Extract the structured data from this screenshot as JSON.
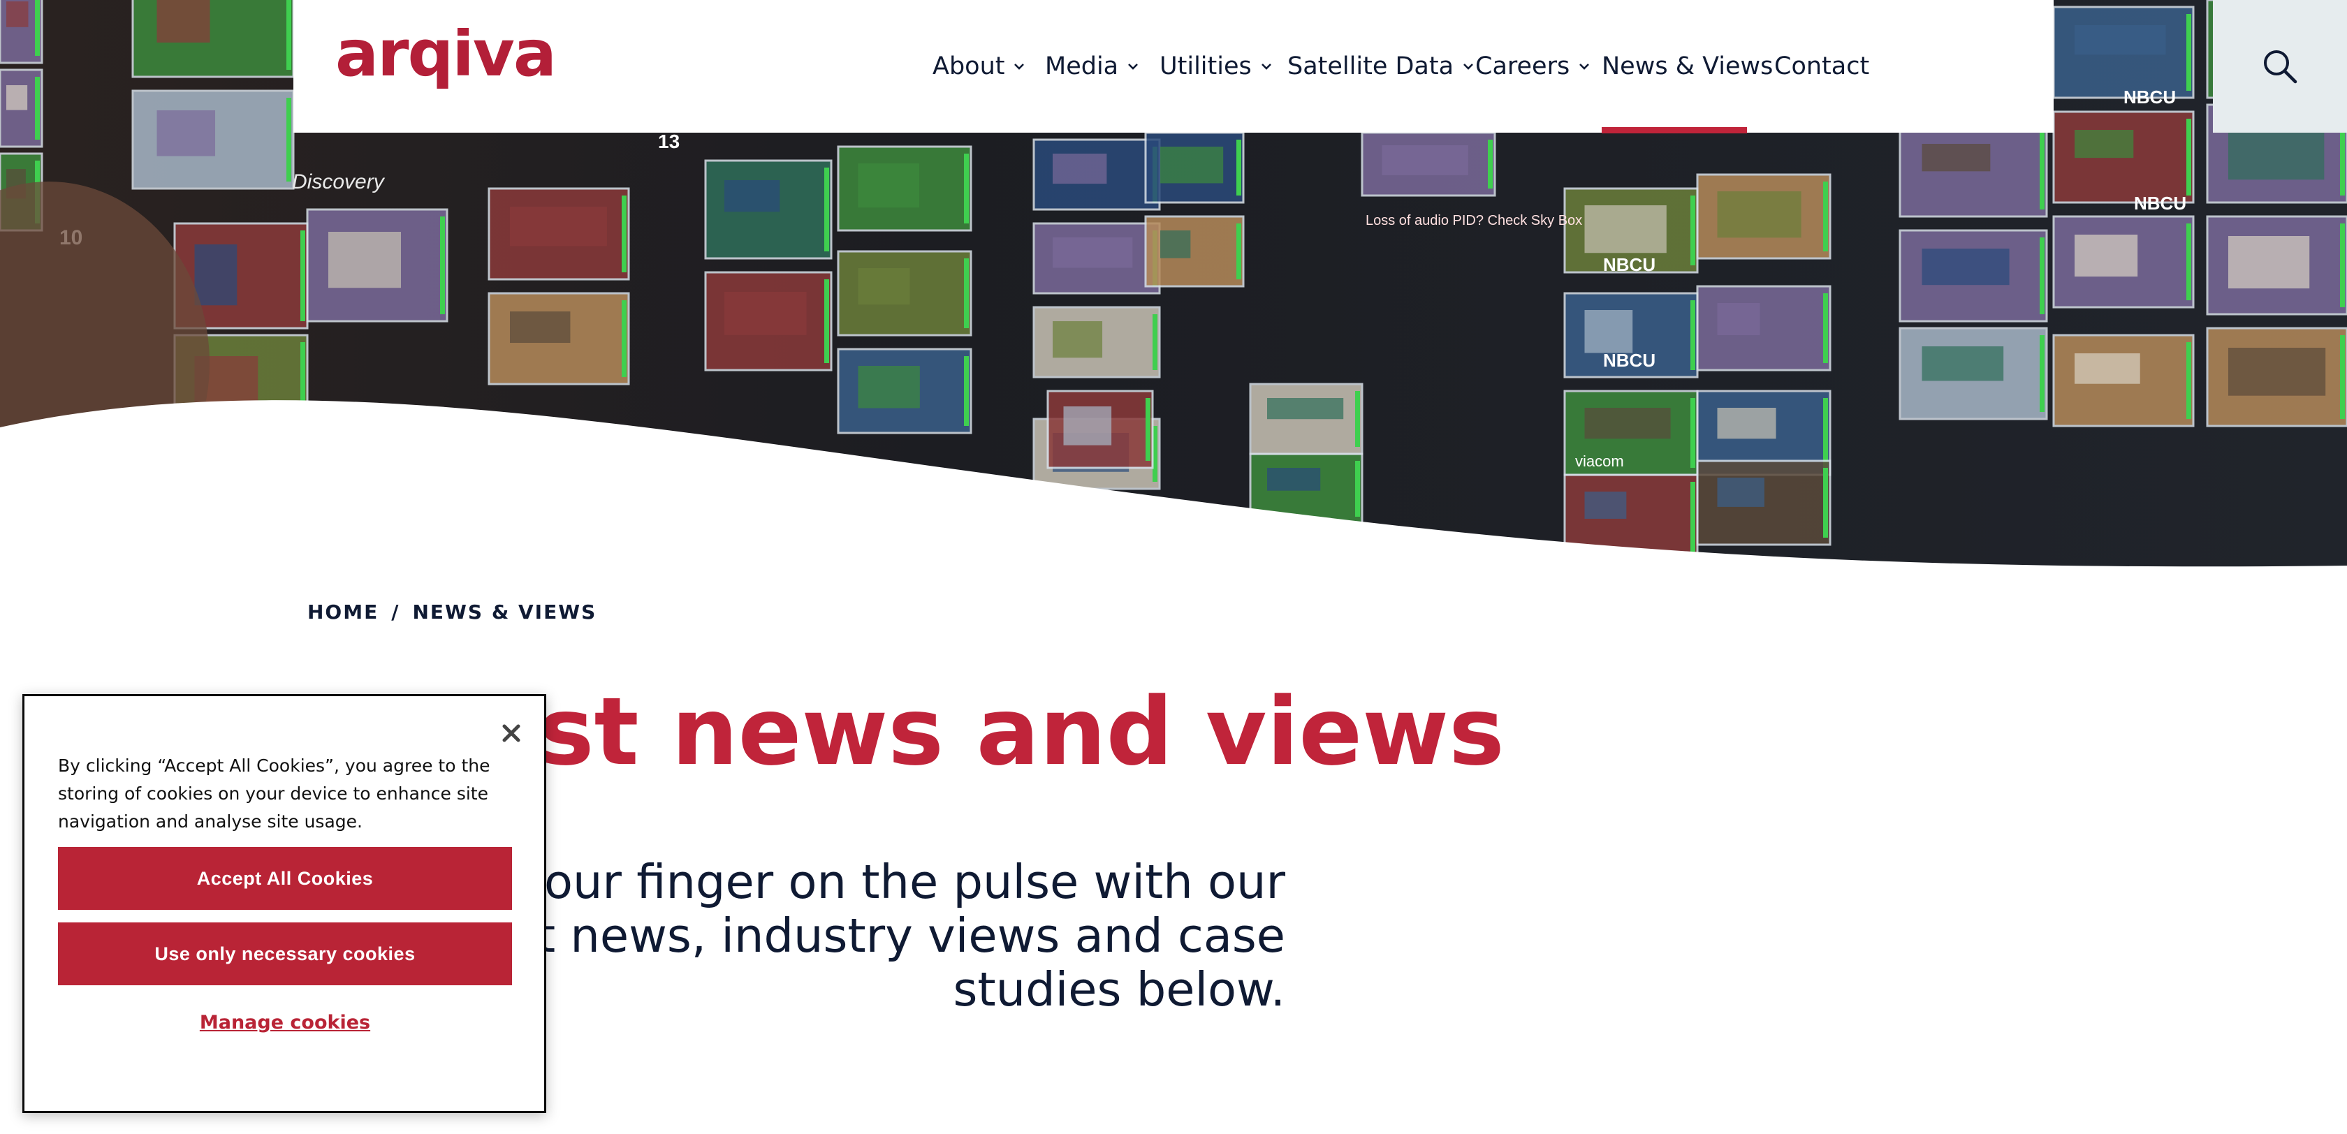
{
  "brand": {
    "logo_text": "arqiva",
    "accent": "#c0243a",
    "text_dark": "#0f1a33"
  },
  "nav": {
    "items": [
      {
        "label": "About",
        "has_dropdown": true
      },
      {
        "label": "Media",
        "has_dropdown": true
      },
      {
        "label": "Utilities",
        "has_dropdown": true
      },
      {
        "label": "Satellite Data",
        "has_dropdown": true
      },
      {
        "label": "Careers",
        "has_dropdown": true
      },
      {
        "label": "News & Views",
        "has_dropdown": false,
        "active": true
      },
      {
        "label": "Contact",
        "has_dropdown": false
      }
    ],
    "search_icon": "search-icon"
  },
  "breadcrumb": {
    "home": "HOME",
    "separator": "/",
    "current": "NEWS & VIEWS"
  },
  "page": {
    "title": "Latest news and views",
    "intro": "Keep your finger on the pulse with our latest news, industry views and case studies below."
  },
  "hero": {
    "screen_labels": [
      "NBCU",
      "NBCU",
      "NBCU",
      "NBCU",
      "Discovery",
      "viacom",
      "Loss of audio PID? Check Sky Box",
      "10",
      "13"
    ]
  },
  "cookie": {
    "message": "By clicking “Accept All Cookies”, you agree to the storing of cookies on your device to enhance site navigation and analyse site usage.",
    "accept_label": "Accept All Cookies",
    "necessary_label": "Use only necessary cookies",
    "manage_label": "Manage cookies",
    "close_icon": "close-icon"
  }
}
